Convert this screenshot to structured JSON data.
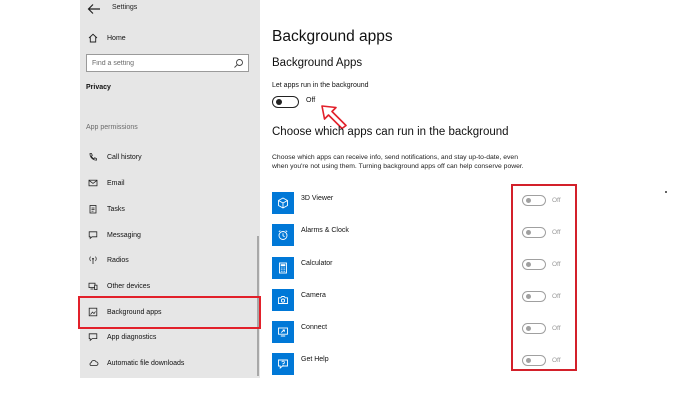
{
  "window": {
    "title": "Settings"
  },
  "sidebar": {
    "home_label": "Home",
    "search_placeholder": "Find a setting",
    "section_title": "Privacy",
    "group_label": "App permissions",
    "items": [
      {
        "label": "Call history",
        "icon": "call-history-icon"
      },
      {
        "label": "Email",
        "icon": "mail-icon"
      },
      {
        "label": "Tasks",
        "icon": "tasks-icon"
      },
      {
        "label": "Messaging",
        "icon": "chat-icon"
      },
      {
        "label": "Radios",
        "icon": "radios-icon"
      },
      {
        "label": "Other devices",
        "icon": "devices-icon"
      },
      {
        "label": "Background apps",
        "icon": "background-apps-icon",
        "selected": true
      },
      {
        "label": "App diagnostics",
        "icon": "diagnostics-icon"
      },
      {
        "label": "Automatic file downloads",
        "icon": "cloud-icon"
      }
    ]
  },
  "main": {
    "page_title": "Background apps",
    "section_title": "Background Apps",
    "toggle_label": "Let apps run in the background",
    "toggle_state": "Off",
    "subsection_title": "Choose which apps can run in the background",
    "description": "Choose which apps can receive info, send notifications, and stay up-to-date, even when you're not using them. Turning background apps off can help conserve power.",
    "apps": [
      {
        "name": "3D Viewer",
        "state": "Off",
        "icon": "cube-icon"
      },
      {
        "name": "Alarms & Clock",
        "state": "Off",
        "icon": "alarm-clock-icon"
      },
      {
        "name": "Calculator",
        "state": "Off",
        "icon": "calculator-icon"
      },
      {
        "name": "Camera",
        "state": "Off",
        "icon": "camera-icon"
      },
      {
        "name": "Connect",
        "state": "Off",
        "icon": "connect-icon"
      },
      {
        "name": "Get Help",
        "state": "Off",
        "icon": "help-icon"
      }
    ]
  },
  "colors": {
    "accent": "#0078d7",
    "annotation": "#e2202a",
    "sidebar_bg": "#e6e6e6"
  }
}
